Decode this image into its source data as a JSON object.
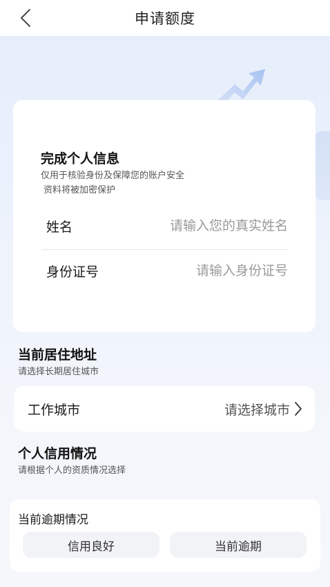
{
  "header": {
    "title": "申请额度"
  },
  "personal_info": {
    "heading": "完成个人信息",
    "note_1": "仅用于核验身份及保障您的账户安全",
    "note_2": "资料将被加密保护",
    "fields": [
      {
        "label": "姓名",
        "placeholder": "请输入您的真实姓名",
        "value": ""
      },
      {
        "label": "身份证号",
        "placeholder": "请输入身份证号",
        "value": ""
      }
    ]
  },
  "address": {
    "title": "当前居住地址",
    "subtitle": "请选择长期居住城市",
    "city_label": "工作城市",
    "city_value": "请选择城市"
  },
  "credit": {
    "title": "个人信用情况",
    "subtitle": "请根据个人的资质情况选择",
    "overdue_label": "当前逾期情况",
    "options": [
      "信用良好",
      "当前逾期"
    ]
  },
  "icons": {
    "back": "chevron-left-icon",
    "city_arrow": "chevron-right-icon",
    "decoration": "upward-arrow-icon"
  },
  "colors": {
    "background_top": "#e6eefb",
    "card": "#ffffff",
    "option_bg": "#f2f3f6",
    "placeholder": "#9a9a9a"
  }
}
